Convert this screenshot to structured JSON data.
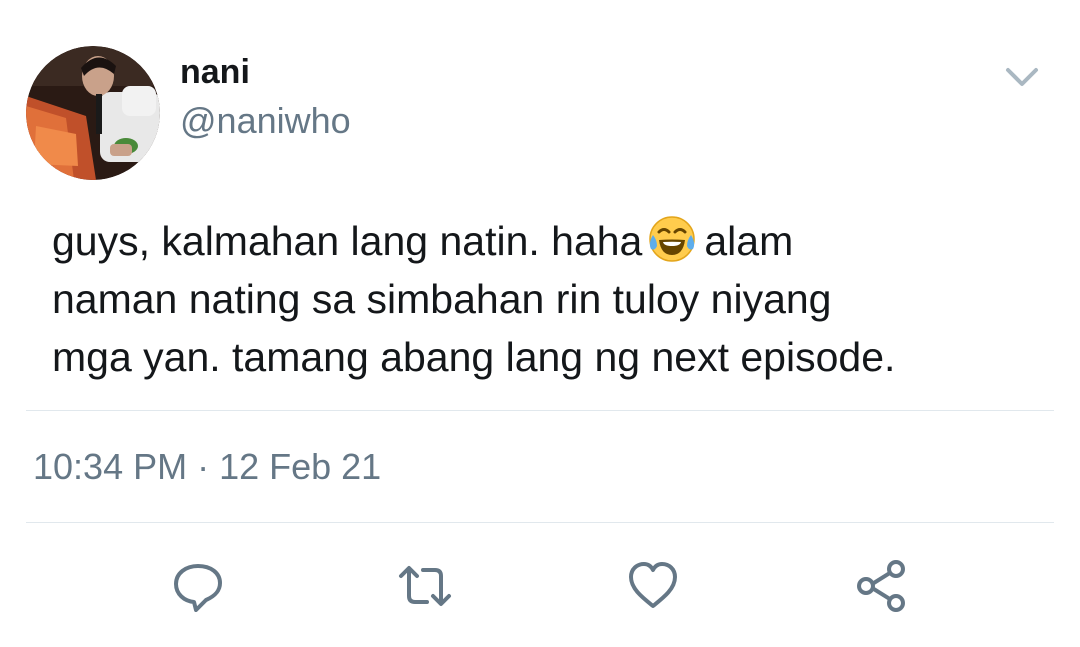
{
  "author": {
    "display_name": "nani",
    "handle": "@naniwho",
    "avatar_icon": "profile-photo"
  },
  "tweet": {
    "lines": [
      {
        "before": "guys, kalmahan lang natin. haha",
        "emoji": "face-with-tears-of-joy",
        "after": "alam"
      },
      {
        "text": "naman nating sa simbahan rin tuloy niyang"
      },
      {
        "text": "mga yan. tamang abang lang ng next episode."
      }
    ],
    "timestamp": "10:34 PM · 12 Feb 21"
  },
  "actions": [
    {
      "name": "reply",
      "icon": "speech-bubble-icon"
    },
    {
      "name": "retweet",
      "icon": "retweet-arrows-icon"
    },
    {
      "name": "like",
      "icon": "heart-icon"
    },
    {
      "name": "share",
      "icon": "share-nodes-icon"
    }
  ],
  "colors": {
    "text_primary": "#14171a",
    "text_secondary": "#657786",
    "icon": "#657786",
    "divider": "#e1e8ed",
    "chevron": "#aab8c2"
  }
}
